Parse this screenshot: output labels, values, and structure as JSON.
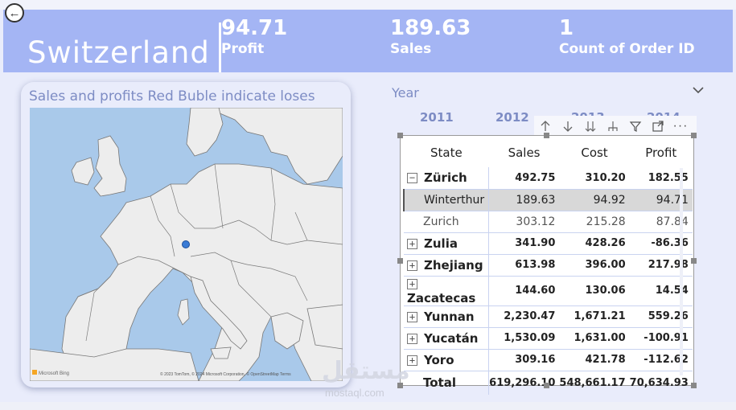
{
  "header": {
    "country": "Switzerland",
    "kpis": [
      {
        "value": "94.71",
        "label": "Profit"
      },
      {
        "value": "189.63",
        "label": "Sales"
      },
      {
        "value": "1",
        "label": "Count of Order ID"
      }
    ],
    "colors": {
      "banner": "#a4b5f4",
      "text": "#ffffff"
    }
  },
  "map": {
    "title": "Sales and profits Red Buble indicate loses",
    "credit": "© 2023 TomTom, © 2024 Microsoft Corporation, © OpenStreetMap  Terms",
    "bing_logo": "Microsoft Bing",
    "marker_color": "#3a7bd5"
  },
  "slicer": {
    "label": "Year",
    "years": [
      "2011",
      "2012",
      "2013",
      "2014"
    ],
    "icon": "chevron-down-icon"
  },
  "toolbar": {
    "icons": [
      "arrow-up-icon",
      "arrow-down-icon",
      "double-arrow-down-icon",
      "expand-hierarchy-icon",
      "filter-icon",
      "focus-mode-icon",
      "more-options-icon"
    ],
    "more_label": "···"
  },
  "table": {
    "columns": [
      "State",
      "Sales",
      "Cost",
      "Profit"
    ],
    "rows": [
      {
        "state": "Zürich",
        "expander": "−",
        "sales": "492.75",
        "cost": "310.20",
        "profit": "182.55"
      },
      {
        "state": "Winterthur",
        "expander": "",
        "sales": "189.63",
        "cost": "94.92",
        "profit": "94.71"
      },
      {
        "state": "Zurich",
        "expander": "",
        "sales": "303.12",
        "cost": "215.28",
        "profit": "87.84"
      },
      {
        "state": "Zulia",
        "expander": "+",
        "sales": "341.90",
        "cost": "428.26",
        "profit": "-86.36"
      },
      {
        "state": "Zhejiang",
        "expander": "+",
        "sales": "613.98",
        "cost": "396.00",
        "profit": "217.98"
      },
      {
        "state": "Zacatecas",
        "expander": "+",
        "sales": "144.60",
        "cost": "130.06",
        "profit": "14.54"
      },
      {
        "state": "Yunnan",
        "expander": "+",
        "sales": "2,230.47",
        "cost": "1,671.21",
        "profit": "559.26"
      },
      {
        "state": "Yucatán",
        "expander": "+",
        "sales": "1,530.09",
        "cost": "1,631.00",
        "profit": "-100.91"
      },
      {
        "state": "Yoro",
        "expander": "+",
        "sales": "309.16",
        "cost": "421.78",
        "profit": "-112.62"
      }
    ],
    "total": {
      "state": "Total",
      "sales": "619,296.10",
      "cost": "548,661.17",
      "profit": "70,634.93"
    }
  },
  "watermark": {
    "text": "مستقل",
    "sub": "mostaql.com"
  }
}
